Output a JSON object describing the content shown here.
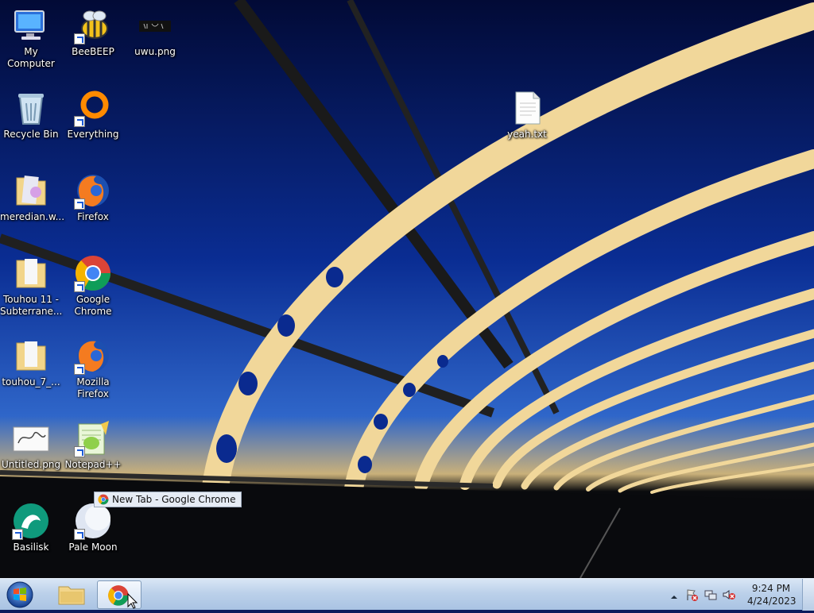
{
  "desktop": {
    "icons": [
      {
        "label": "My Computer",
        "icon": "computer-icon"
      },
      {
        "label": "BeeBEEP",
        "icon": "bee-icon"
      },
      {
        "label": "uwu.png",
        "icon": "image-file-icon"
      },
      {
        "label": "Recycle Bin",
        "icon": "recycle-bin-icon"
      },
      {
        "label": "Everything",
        "icon": "everything-search-icon"
      },
      {
        "label": "yeah.txt",
        "icon": "text-file-icon"
      },
      {
        "label": "meredian.w...",
        "icon": "folder-icon"
      },
      {
        "label": "Firefox",
        "icon": "firefox-icon"
      },
      {
        "label": "Touhou 11 - Subterrane...",
        "icon": "folder-icon"
      },
      {
        "label": "Google Chrome",
        "icon": "chrome-icon"
      },
      {
        "label": "touhou_7_...",
        "icon": "folder-icon"
      },
      {
        "label": "Mozilla Firefox",
        "icon": "firefox-icon"
      },
      {
        "label": "Untitled.png",
        "icon": "image-file-icon"
      },
      {
        "label": "Notepad++",
        "icon": "notepadplusplus-icon"
      },
      {
        "label": "Basilisk",
        "icon": "basilisk-icon"
      },
      {
        "label": "Pale Moon",
        "icon": "pale-moon-icon"
      }
    ]
  },
  "tooltip": {
    "text": "New Tab - Google Chrome",
    "icon": "chrome-icon"
  },
  "taskbar": {
    "buttons": [
      {
        "name": "start-button",
        "icon": "windows-logo-icon"
      },
      {
        "name": "file-explorer",
        "icon": "folder-icon"
      },
      {
        "name": "google-chrome",
        "icon": "chrome-icon",
        "active": true
      }
    ],
    "tray": {
      "icons": [
        "show-hidden-icons-icon",
        "action-center-flag-icon",
        "network-icon",
        "volume-muted-icon"
      ],
      "time": "9:24 PM",
      "date": "4/24/2023"
    }
  },
  "colors": {
    "taskbar": "#bcd1ea",
    "sky": "#0a2a8f",
    "bridge": "#f0d08a"
  }
}
